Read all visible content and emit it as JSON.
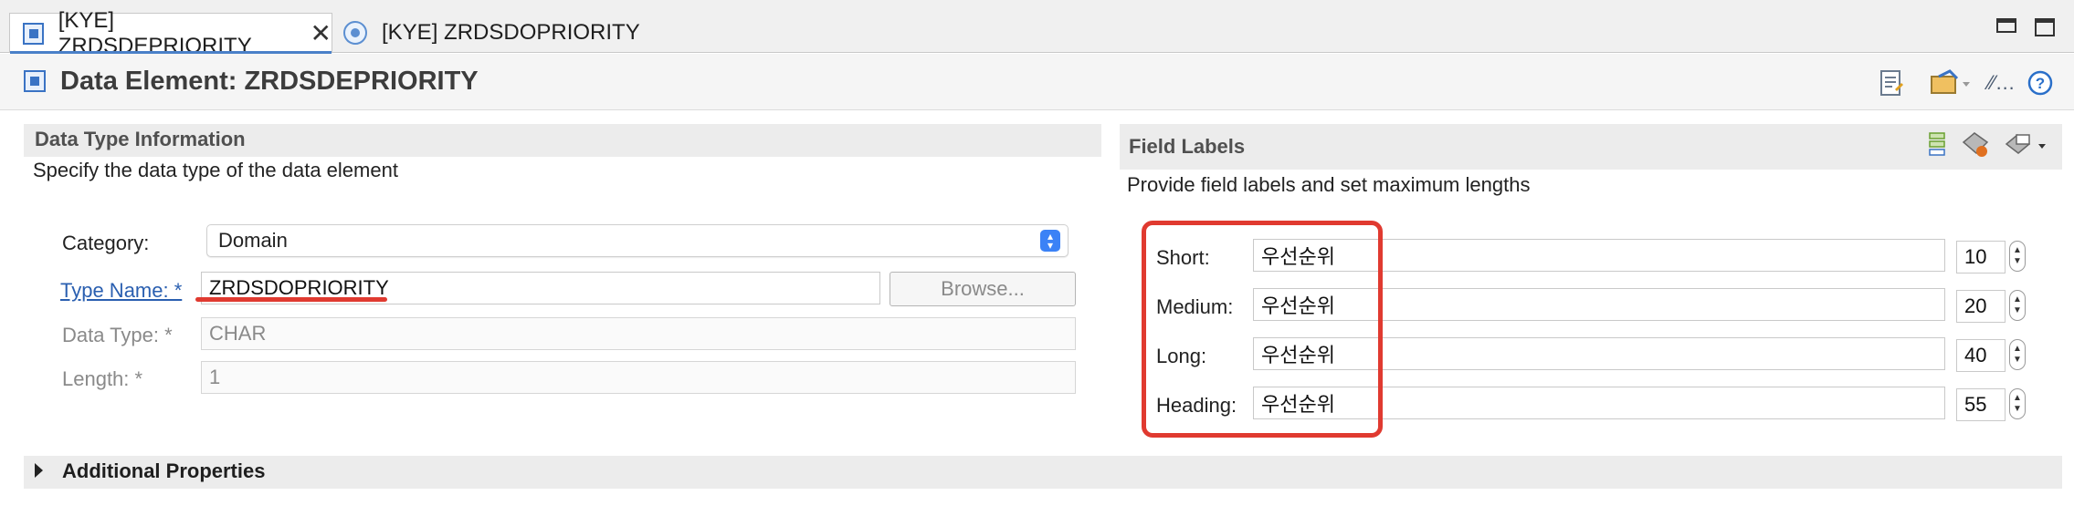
{
  "tabs": [
    {
      "label": "[KYE] ZRDSDEPRIORITY",
      "icon": "data-element-icon",
      "active": true
    },
    {
      "label": "[KYE] ZRDSDOPRIORITY",
      "icon": "domain-icon",
      "active": false
    }
  ],
  "header": {
    "title": "Data Element: ZRDSDEPRIORITY",
    "tools": [
      "notes-icon",
      "transport-icon",
      "format-icon",
      "help-icon"
    ]
  },
  "data_type_section": {
    "title": "Data Type Information",
    "description": "Specify the data type of the data element",
    "category_label": "Category:",
    "category_value": "Domain",
    "type_name_label": "Type Name: *",
    "type_name_value": "ZRDSDOPRIORITY",
    "browse_label": "Browse...",
    "data_type_label": "Data Type: *",
    "data_type_value": "CHAR",
    "length_label": "Length: *",
    "length_value": "1"
  },
  "field_labels_section": {
    "title": "Field Labels",
    "description": "Provide field labels and set maximum lengths",
    "rows": [
      {
        "label": "Short:",
        "value": "우선순위",
        "max_length": "10"
      },
      {
        "label": "Medium:",
        "value": "우선순위",
        "max_length": "20"
      },
      {
        "label": "Long:",
        "value": "우선순위",
        "max_length": "40"
      },
      {
        "label": "Heading:",
        "value": "우선순위",
        "max_length": "55"
      }
    ]
  },
  "additional_properties": {
    "title": "Additional Properties"
  },
  "colors": {
    "highlight_box": "#e03a30",
    "underline_annotation": "#e03a30",
    "link": "#2a5fb0",
    "accent": "#3b82f6"
  }
}
